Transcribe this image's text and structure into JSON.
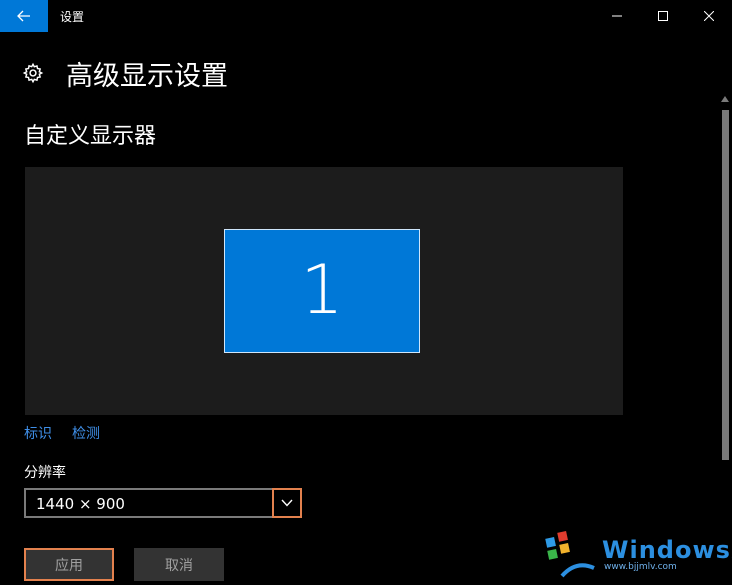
{
  "titlebar": {
    "app_title": "设置",
    "back_icon": "back-arrow-icon",
    "minimize_icon": "minimize-icon",
    "maximize_icon": "maximize-icon",
    "close_icon": "close-icon",
    "accent_color": "#0078d7"
  },
  "header": {
    "icon": "gear-icon",
    "title": "高级显示设置"
  },
  "section": {
    "title": "自定义显示器"
  },
  "arrangement": {
    "monitor_label": "1",
    "monitor_color": "#0078d7",
    "identify_link": "标识",
    "detect_link": "检测"
  },
  "resolution": {
    "label": "分辨率",
    "value": "1440 × 900",
    "toggle_icon": "chevron-down-icon",
    "highlight_color": "#e3814e"
  },
  "actions": {
    "apply_label": "应用",
    "cancel_label": "取消"
  },
  "watermark": {
    "text": "Windows系统之家",
    "sub": "www.bjjmlv.com"
  }
}
